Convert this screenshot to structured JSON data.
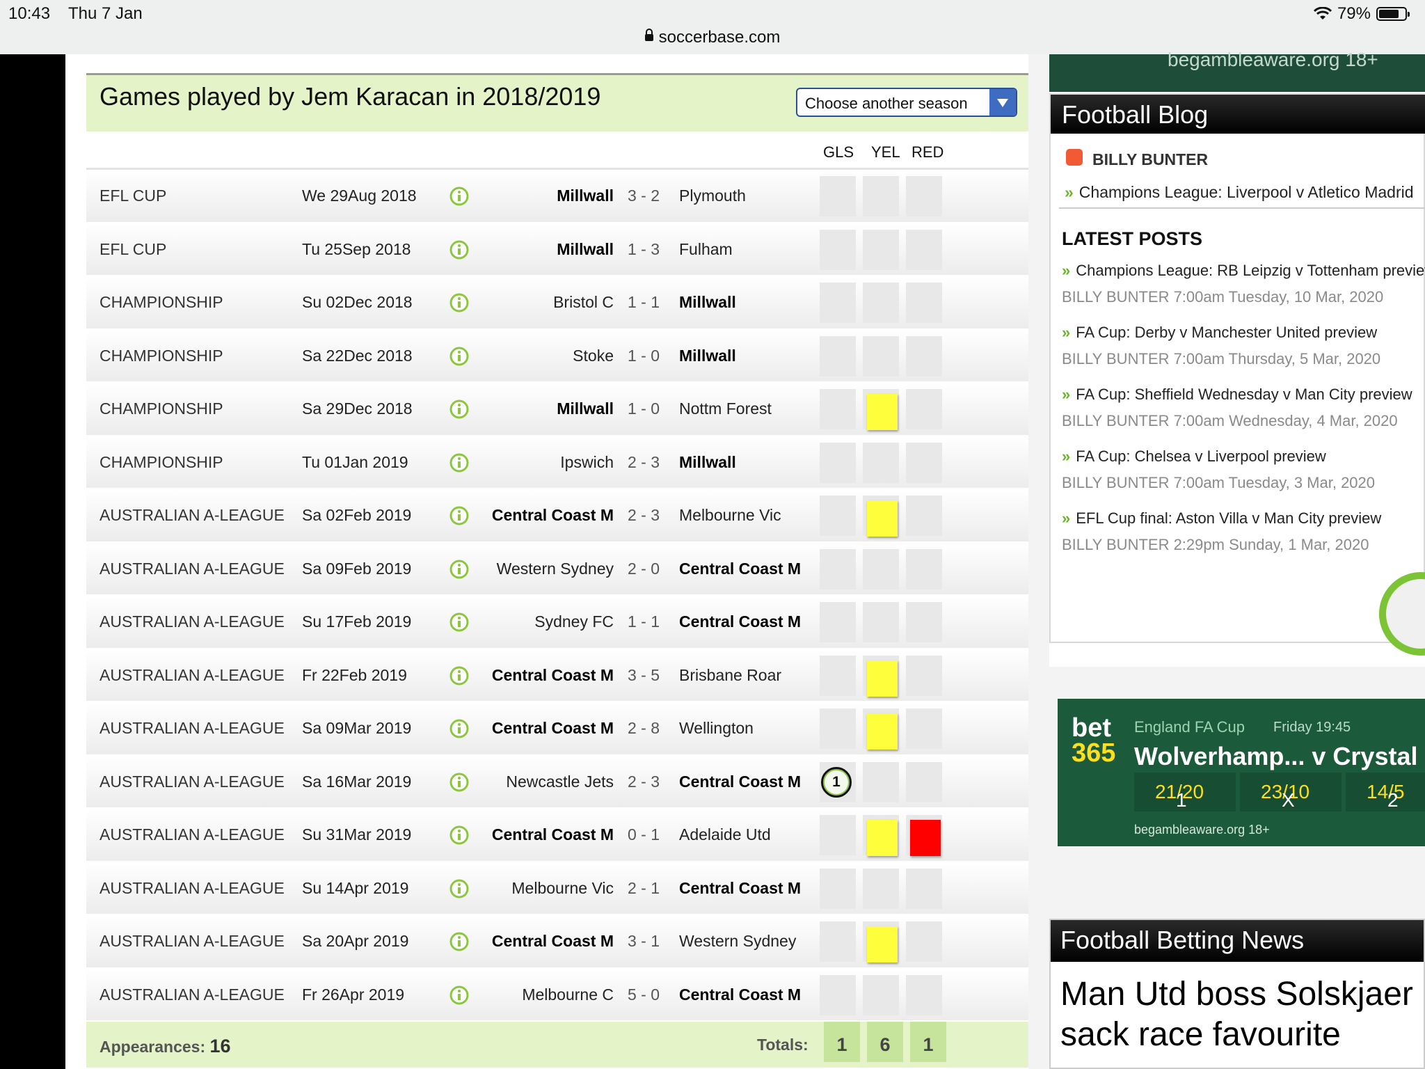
{
  "status": {
    "time": "10:43",
    "date": "Thu 7 Jan",
    "url": "soccerbase.com",
    "battery": "79%",
    "battery_level": 0.79
  },
  "page": {
    "title": "Games played by Jem Karacan in 2018/2019",
    "season_select": "Choose another season",
    "col_gls": "GLS",
    "col_yel": "YEL",
    "col_red": "RED"
  },
  "games": [
    {
      "comp": "EFL CUP",
      "date": "We 29Aug 2018",
      "home": "Millwall",
      "score": "3 - 2",
      "away": "Plymouth",
      "bold": "home",
      "goals": "",
      "yellow": false,
      "red": false
    },
    {
      "comp": "EFL CUP",
      "date": "Tu 25Sep 2018",
      "home": "Millwall",
      "score": "1 - 3",
      "away": "Fulham",
      "bold": "home",
      "goals": "",
      "yellow": false,
      "red": false
    },
    {
      "comp": "CHAMPIONSHIP",
      "date": "Su 02Dec 2018",
      "home": "Bristol C",
      "score": "1 - 1",
      "away": "Millwall",
      "bold": "away",
      "goals": "",
      "yellow": false,
      "red": false
    },
    {
      "comp": "CHAMPIONSHIP",
      "date": "Sa 22Dec 2018",
      "home": "Stoke",
      "score": "1 - 0",
      "away": "Millwall",
      "bold": "away",
      "goals": "",
      "yellow": false,
      "red": false
    },
    {
      "comp": "CHAMPIONSHIP",
      "date": "Sa 29Dec 2018",
      "home": "Millwall",
      "score": "1 - 0",
      "away": "Nottm Forest",
      "bold": "home",
      "goals": "",
      "yellow": true,
      "red": false
    },
    {
      "comp": "CHAMPIONSHIP",
      "date": "Tu 01Jan 2019",
      "home": "Ipswich",
      "score": "2 - 3",
      "away": "Millwall",
      "bold": "away",
      "goals": "",
      "yellow": false,
      "red": false
    },
    {
      "comp": "AUSTRALIAN A-LEAGUE",
      "date": "Sa 02Feb 2019",
      "home": "Central Coast M",
      "score": "2 - 3",
      "away": "Melbourne Vic",
      "bold": "home",
      "goals": "",
      "yellow": true,
      "red": false
    },
    {
      "comp": "AUSTRALIAN A-LEAGUE",
      "date": "Sa 09Feb 2019",
      "home": "Western Sydney",
      "score": "2 - 0",
      "away": "Central Coast M",
      "bold": "away",
      "goals": "",
      "yellow": false,
      "red": false
    },
    {
      "comp": "AUSTRALIAN A-LEAGUE",
      "date": "Su 17Feb 2019",
      "home": "Sydney FC",
      "score": "1 - 1",
      "away": "Central Coast M",
      "bold": "away",
      "goals": "",
      "yellow": false,
      "red": false
    },
    {
      "comp": "AUSTRALIAN A-LEAGUE",
      "date": "Fr 22Feb 2019",
      "home": "Central Coast M",
      "score": "3 - 5",
      "away": "Brisbane Roar",
      "bold": "home",
      "goals": "",
      "yellow": true,
      "red": false
    },
    {
      "comp": "AUSTRALIAN A-LEAGUE",
      "date": "Sa 09Mar 2019",
      "home": "Central Coast M",
      "score": "2 - 8",
      "away": "Wellington",
      "bold": "home",
      "goals": "",
      "yellow": true,
      "red": false
    },
    {
      "comp": "AUSTRALIAN A-LEAGUE",
      "date": "Sa 16Mar 2019",
      "home": "Newcastle Jets",
      "score": "2 - 3",
      "away": "Central Coast M",
      "bold": "away",
      "goals": "1",
      "yellow": false,
      "red": false
    },
    {
      "comp": "AUSTRALIAN A-LEAGUE",
      "date": "Su 31Mar 2019",
      "home": "Central Coast M",
      "score": "0 - 1",
      "away": "Adelaide Utd",
      "bold": "home",
      "goals": "",
      "yellow": true,
      "red": true
    },
    {
      "comp": "AUSTRALIAN A-LEAGUE",
      "date": "Su 14Apr 2019",
      "home": "Melbourne Vic",
      "score": "2 - 1",
      "away": "Central Coast M",
      "bold": "away",
      "goals": "",
      "yellow": false,
      "red": false
    },
    {
      "comp": "AUSTRALIAN A-LEAGUE",
      "date": "Sa 20Apr 2019",
      "home": "Central Coast M",
      "score": "3 - 1",
      "away": "Western Sydney",
      "bold": "home",
      "goals": "",
      "yellow": true,
      "red": false
    },
    {
      "comp": "AUSTRALIAN A-LEAGUE",
      "date": "Fr 26Apr 2019",
      "home": "Melbourne C",
      "score": "5 - 0",
      "away": "Central Coast M",
      "bold": "away",
      "goals": "",
      "yellow": false,
      "red": false
    }
  ],
  "footer": {
    "appearances_label": "Appearances:",
    "appearances": "16",
    "totals_label": "Totals:",
    "gls": "1",
    "yel": "6",
    "red": "1"
  },
  "sidebar": {
    "top_ad_text": "begambleaware.org 18+",
    "blog_title": "Football Blog",
    "blog_author": "BILLY BUNTER",
    "featured": "Champions League: Liverpool v Atletico Madrid",
    "latest_title": "LATEST POSTS",
    "posts": [
      {
        "title": "Champions League: RB Leipzig v Tottenham preview",
        "meta": "BILLY BUNTER 7:00am Tuesday, 10 Mar, 2020"
      },
      {
        "title": "FA Cup: Derby v Manchester United preview",
        "meta": "BILLY BUNTER 7:00am Thursday, 5 Mar, 2020"
      },
      {
        "title": "FA Cup: Sheffield Wednesday v Man City preview",
        "meta": "BILLY BUNTER 7:00am Wednesday, 4 Mar, 2020"
      },
      {
        "title": "FA Cup: Chelsea v Liverpool preview",
        "meta": "BILLY BUNTER 7:00am Tuesday, 3 Mar, 2020"
      },
      {
        "title": "EFL Cup final: Aston Villa v Man City preview",
        "meta": "BILLY BUNTER 2:29pm Sunday, 1 Mar, 2020"
      }
    ],
    "bet": {
      "logo_top": "bet",
      "logo_bottom": "365",
      "competition": "England FA Cup",
      "time": "Friday 19:45",
      "match": "Wolverhamp...  v Crystal Palace",
      "odds1_label": "1",
      "odds1": "21/20",
      "oddsx_label": "X",
      "oddsx": "23/10",
      "odds2_label": "2",
      "odds2": "14/5",
      "gamble": "begambleaware.org 18+"
    },
    "news_title": "Football Betting News",
    "news_headline_1": "Man Utd boss Solskjaer",
    "news_headline_2": "sack race favourite"
  }
}
